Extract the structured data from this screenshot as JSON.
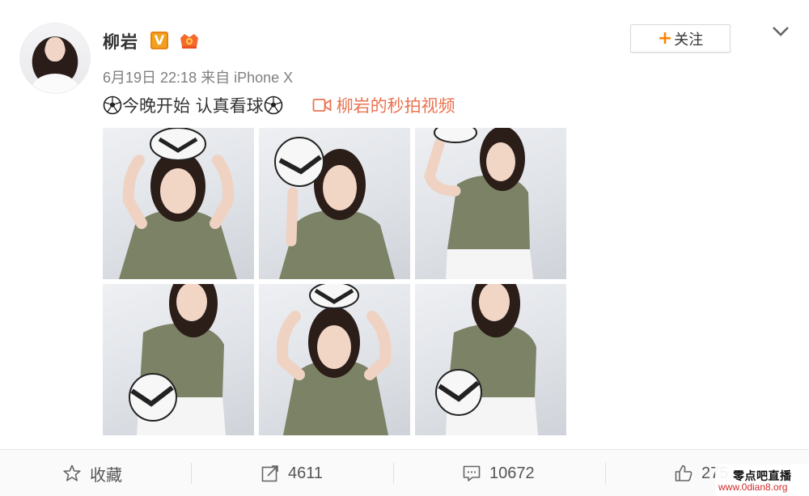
{
  "post": {
    "username": "柳岩",
    "verified_badge": "V",
    "member_badge_icon": "crown-badge-icon",
    "follow_label": "关注",
    "follow_plus": "+",
    "timestamp": "6月19日 22:18",
    "source": "来自 iPhone X",
    "text": "今晚开始 认真看球",
    "video_link": "柳岩的秒拍视频",
    "colors": {
      "link": "#eb7350",
      "follow_plus": "#ff8200",
      "verified": "#f2a11c"
    }
  },
  "gallery": {
    "photos": [
      {
        "id": "photo-1",
        "pose": "ball-on-head"
      },
      {
        "id": "photo-2",
        "pose": "ball-left-shoulder"
      },
      {
        "id": "photo-3",
        "pose": "ball-raised-left"
      },
      {
        "id": "photo-4",
        "pose": "ball-under-arm"
      },
      {
        "id": "photo-5",
        "pose": "ball-on-head"
      },
      {
        "id": "photo-6",
        "pose": "ball-under-arm"
      }
    ]
  },
  "actions": {
    "favorite": {
      "label": "收藏",
      "icon": "star-icon"
    },
    "forward": {
      "count": "4611",
      "icon": "share-icon"
    },
    "comment": {
      "count": "10672",
      "icon": "comment-icon"
    },
    "like": {
      "count": "275",
      "icon": "thumbs-up-icon"
    }
  },
  "watermark": {
    "name": "零点吧直播",
    "url": "www.0dian8.org"
  }
}
